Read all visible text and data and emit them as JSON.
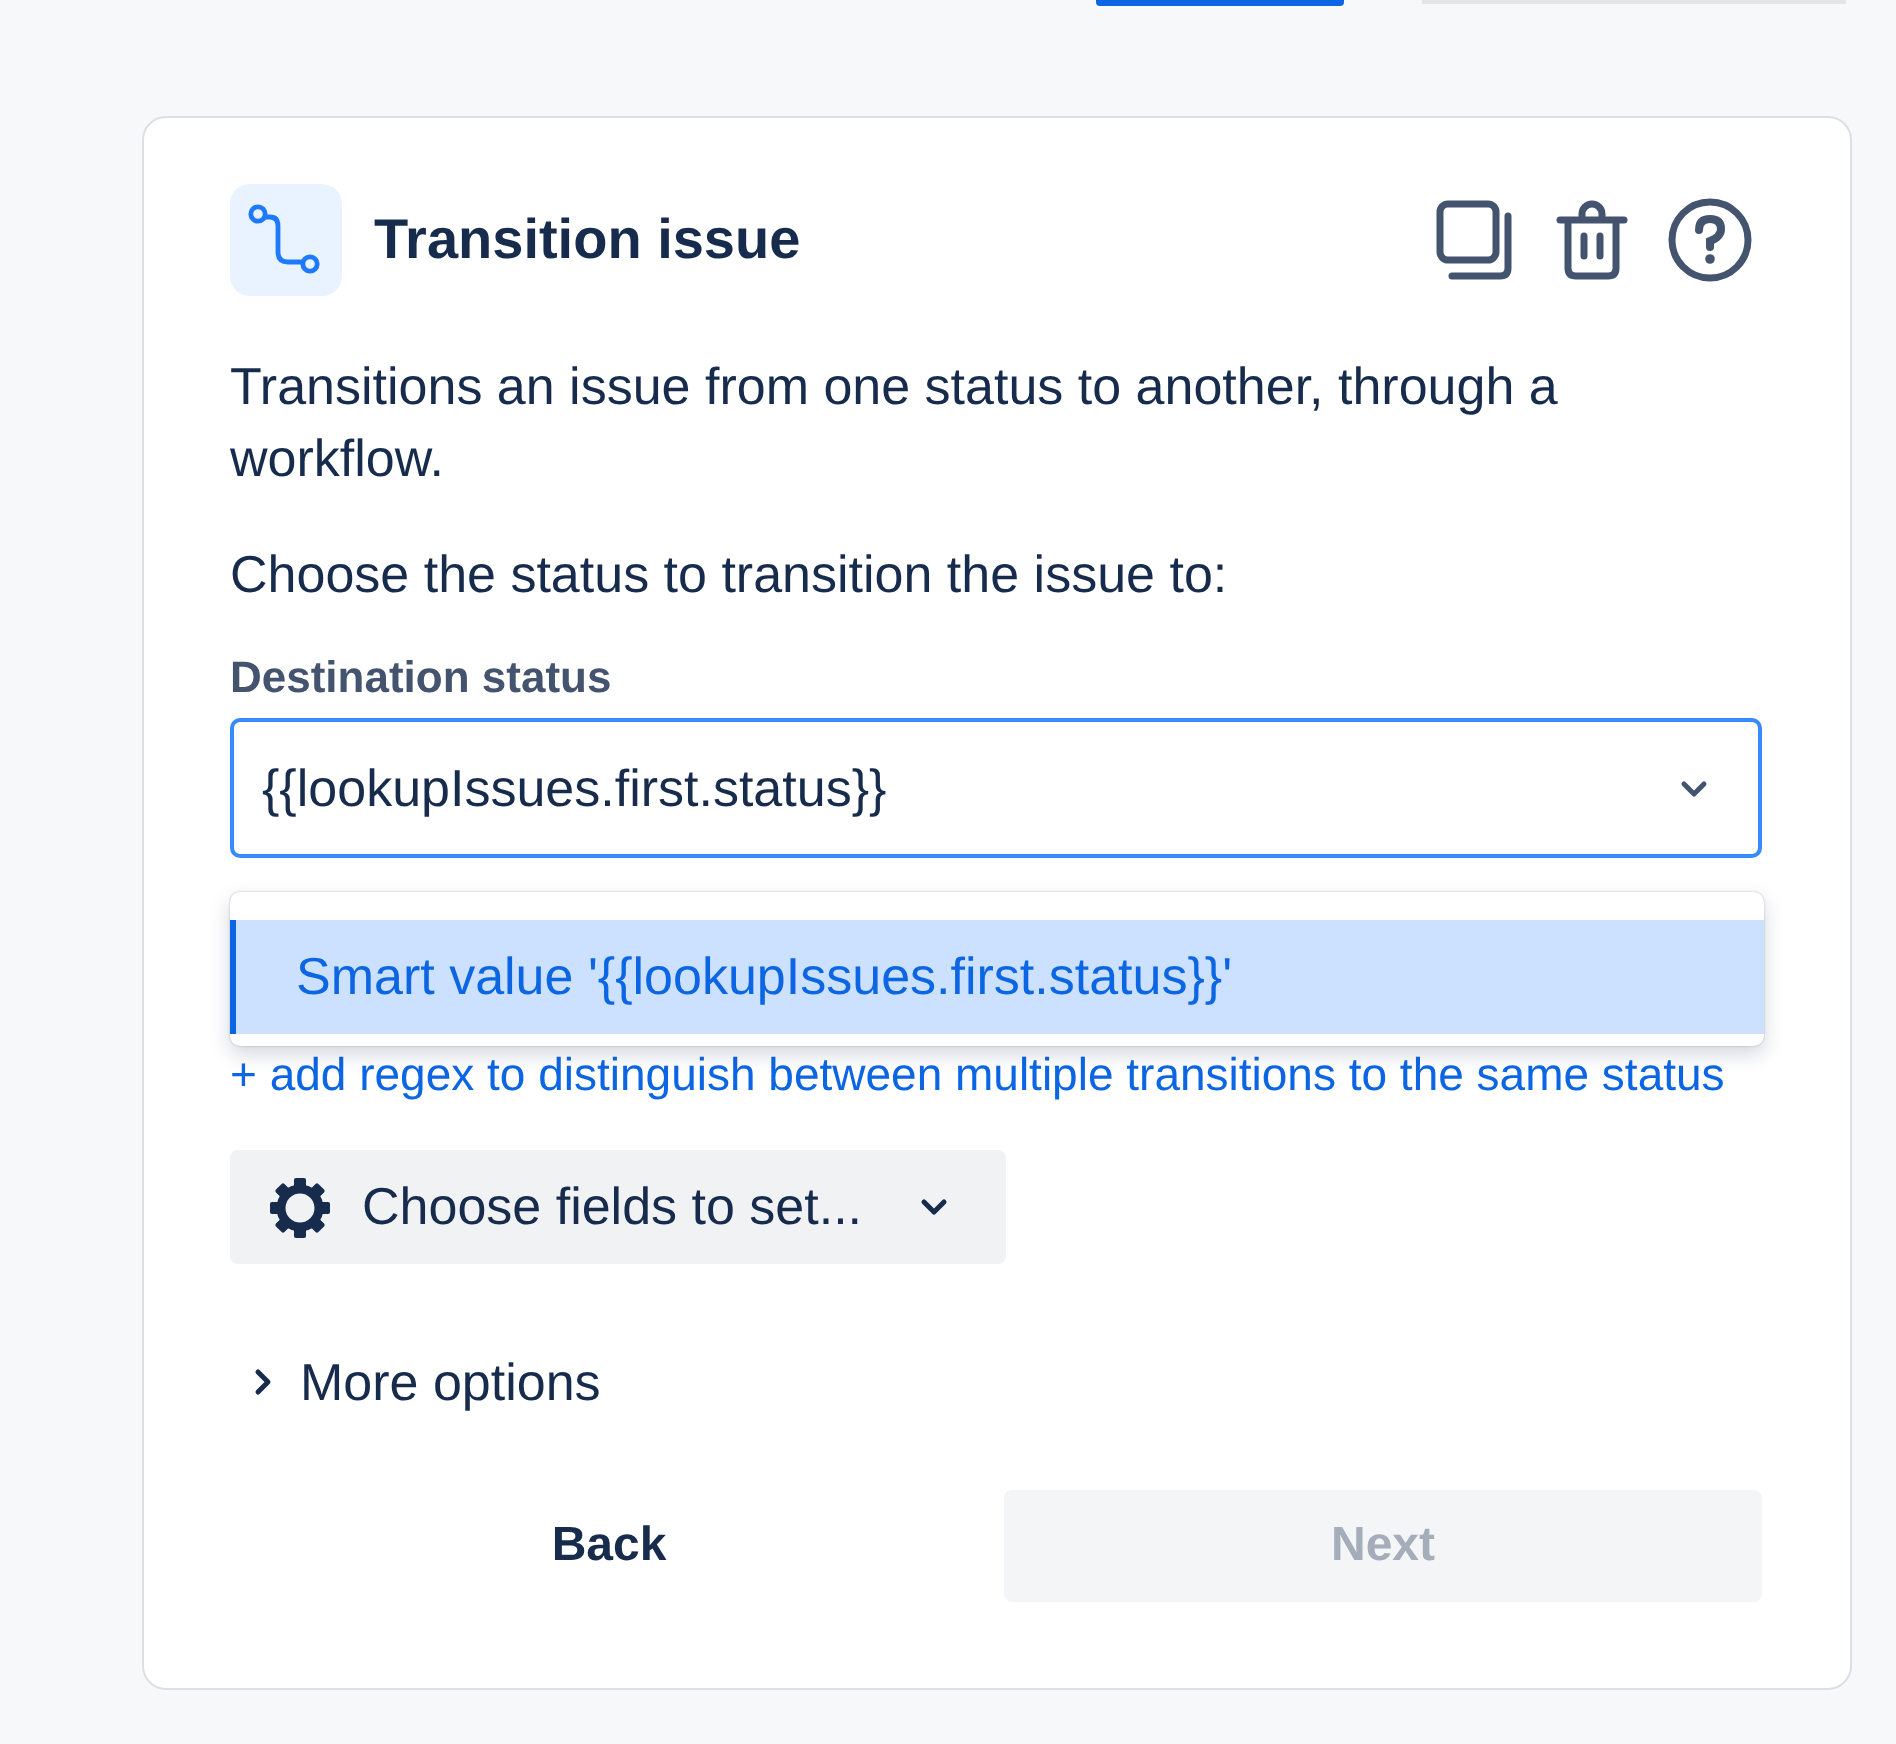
{
  "card": {
    "title": "Transition issue",
    "description": "Transitions an issue from one status to another, through a workflow.",
    "prompt": "Choose the status to transition the issue to:"
  },
  "destination_status": {
    "label": "Destination status",
    "value": "{{lookupIssues.first.status}}",
    "expanded": true,
    "options": [
      {
        "label": "Smart value '{{lookupIssues.first.status}}'",
        "selected": true
      }
    ]
  },
  "regex_link": "+ add regex to distinguish between multiple transitions to the same status",
  "fields_button": "Choose fields to set...",
  "more_options": {
    "label": "More options",
    "expanded": false
  },
  "buttons": [
    {
      "label": "Back",
      "disabled": false
    },
    {
      "label": "Next",
      "disabled": true
    }
  ]
}
